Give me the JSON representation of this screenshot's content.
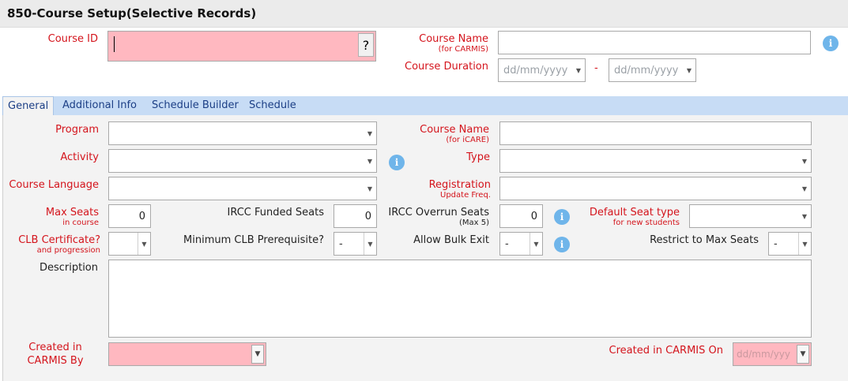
{
  "window": {
    "title": "850-Course Setup(Selective Records)"
  },
  "header": {
    "course_id": {
      "label": "Course ID",
      "value": "",
      "lookup_label": "?"
    },
    "course_name": {
      "label": "Course Name",
      "sub": "(for CARMIS)",
      "value": ""
    },
    "course_duration": {
      "label": "Course Duration",
      "start_placeholder": "dd/mm/yyyy",
      "separator": "-",
      "end_placeholder": "dd/mm/yyyy"
    }
  },
  "tabs": [
    {
      "label": "General",
      "active": true
    },
    {
      "label": "Additional Info",
      "active": false
    },
    {
      "label": "Schedule Builder",
      "active": false
    },
    {
      "label": "Schedule",
      "active": false
    }
  ],
  "general": {
    "program": {
      "label": "Program",
      "value": ""
    },
    "course_name_icare": {
      "label": "Course Name",
      "sub": "(for iCARE)",
      "value": ""
    },
    "activity": {
      "label": "Activity",
      "value": ""
    },
    "type": {
      "label": "Type",
      "value": ""
    },
    "course_language": {
      "label": "Course Language",
      "value": ""
    },
    "registration": {
      "label": "Registration",
      "sub": "Update Freq.",
      "value": ""
    },
    "max_seats": {
      "label": "Max Seats",
      "sub": "in course",
      "value": "0"
    },
    "ircc_funded_seats": {
      "label": "IRCC Funded Seats",
      "value": "0"
    },
    "ircc_overrun_seats": {
      "label": "IRCC Overrun Seats",
      "sub": "(Max 5)",
      "value": "0"
    },
    "default_seat_type": {
      "label": "Default Seat type",
      "sub": "for new students",
      "value": ""
    },
    "clb_certificate": {
      "label": "CLB Certificate?",
      "sub": "and progression",
      "value": ""
    },
    "min_clb_prereq": {
      "label": "Minimum CLB Prerequisite?",
      "value": "-"
    },
    "allow_bulk_exit": {
      "label": "Allow Bulk Exit",
      "value": "-"
    },
    "restrict_max_seats": {
      "label": "Restrict to Max Seats",
      "value": "-"
    },
    "description": {
      "label": "Description",
      "value": ""
    },
    "created_by": {
      "label1": "Created in",
      "label2": "CARMIS By",
      "value": ""
    },
    "created_on": {
      "label": "Created in CARMIS On",
      "placeholder": "dd/mm/yyy"
    }
  },
  "icons": {
    "info": "info-icon",
    "dropdown": "chevron-down-icon",
    "lookup": "question-icon"
  },
  "colors": {
    "required_label": "#d4141c",
    "required_field": "#ffb8c0",
    "tab_bar": "#c7dcf5",
    "info": "#6fb5ea"
  }
}
